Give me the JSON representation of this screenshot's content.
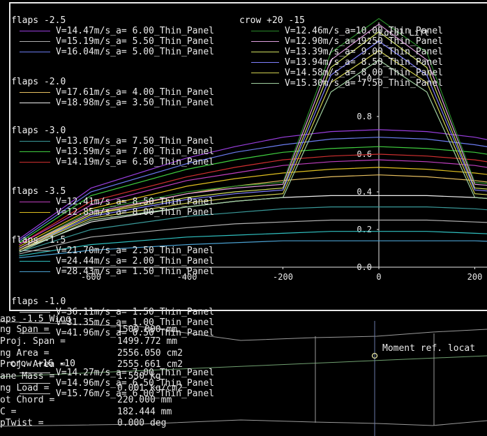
{
  "header": {
    "crow_group": "crow +20 -15"
  },
  "axes": {
    "x_ticks": [
      "-600",
      "-400",
      "-200",
      "0",
      "200"
    ],
    "y_ticks": [
      "0.0",
      "0.2",
      "0.4",
      "0.6",
      "0.8",
      "1.0",
      "1.2"
    ],
    "y_axis_label": "Local Lift"
  },
  "legend_left": {
    "g1": {
      "label": "flaps -2.5",
      "items": [
        {
          "text": "V=14.47m/s_a= 6.00_Thin_Panel",
          "color": "#9b3fe0"
        },
        {
          "text": "V=15.19m/s_a= 5.50_Thin_Panel",
          "color": "#b0b0b0"
        },
        {
          "text": "V=16.04m/s_a= 5.00_Thin_Panel",
          "color": "#6b7cf0"
        }
      ]
    },
    "g2": {
      "label": "flaps -2.0",
      "items": [
        {
          "text": "V=17.61m/s_a= 4.00_Thin_Panel",
          "color": "#e8c060"
        },
        {
          "text": "V=18.98m/s_a= 3.50_Thin_Panel",
          "color": "#f0f0f0"
        }
      ]
    },
    "g3": {
      "label": "flaps -3.0",
      "items": [
        {
          "text": "V=13.07m/s_a= 7.50_Thin_Panel",
          "color": "#3a9a9a"
        },
        {
          "text": "V=13.59m/s_a= 7.00_Thin_Panel",
          "color": "#40d040"
        },
        {
          "text": "V=14.19m/s_a= 6.50_Thin_Panel",
          "color": "#d03030"
        }
      ]
    },
    "g4": {
      "label": "flaps -3.5",
      "items": [
        {
          "text": "V=12.41m/s_a= 8.50_Thin_Panel",
          "color": "#c040c0"
        },
        {
          "text": "V=12.85m/s_a= 8.00_Thin_Panel",
          "color": "#e0c020"
        }
      ]
    },
    "g5": {
      "label": "flaps -1.5",
      "items": [
        {
          "text": "V=21.70m/s_a= 2.50_Thin_Panel",
          "color": "#b0b0b0"
        },
        {
          "text": "V=24.44m/s_a= 2.00_Thin_Panel",
          "color": "#30c0c0"
        },
        {
          "text": "V=28.43m/s_a= 1.50_Thin_Panel",
          "color": "#4aa0d0"
        }
      ]
    },
    "g6": {
      "label": "flaps -1.0",
      "items": [
        {
          "text": "V=36.11m/s_a= 1.50_Thin_Panel",
          "color": "#d0d0d0"
        },
        {
          "text": "V=31.35m/s_a= 1.00_Thin_Panel",
          "color": "#d0d0d0"
        },
        {
          "text": "V=41.96m/s_a= 0.50_Thin_Panel",
          "color": "#d0d0d0"
        }
      ]
    },
    "g7": {
      "label": "crow +16 -10",
      "items": [
        {
          "text": "V=14.27m/s_a= 7.00_Thin_Panel",
          "color": "#d0d0d0"
        },
        {
          "text": "V=14.96m/s_a= 6.50_Thin_Panel",
          "color": "#d0d0d0"
        },
        {
          "text": "V=15.76m/s_a= 6.00_Thin_Panel",
          "color": "#d0d0d0"
        }
      ]
    }
  },
  "legend_right": [
    {
      "text": "V=12.46m/s_a=10.00_Thin_Panel",
      "color": "#2a8a2a"
    },
    {
      "text": "V=12.90m/s_a= 9.50_Thin_Panel",
      "color": "#e0a0e0"
    },
    {
      "text": "V=13.39m/s_a= 9.00_Thin_Panel",
      "color": "#d0e060"
    },
    {
      "text": "V=13.94m/s_a= 8.50_Thin_Panel",
      "color": "#8080ff"
    },
    {
      "text": "V=14.58m/s_a= 8.00_Thin_Panel",
      "color": "#d0d050"
    },
    {
      "text": "V=15.30m/s_a= 7.50_Thin_Panel",
      "color": "#a0d0a0"
    }
  ],
  "wing_info": {
    "wing_name": "aps -1.5 Wing",
    "rows": [
      {
        "label": "ng Span =",
        "value": "1500.000 mm"
      },
      {
        "label": "Proj. Span =",
        "value": "1499.772 mm"
      },
      {
        "label": "ng Area =",
        "value": "2556.050 cm2"
      },
      {
        "label": "Proj. Area =",
        "value": "2555.661 cm2"
      },
      {
        "label": "ane Mass =",
        "value": "1.530 kg"
      },
      {
        "label": "ng Load =",
        "value": "0.001 kg/cm2"
      },
      {
        "label": "ot Chord =",
        "value": "220.000 mm"
      },
      {
        "label": "C =",
        "value": "182.444 mm"
      },
      {
        "label": "pTwist =",
        "value": "0.000 deg"
      }
    ]
  },
  "planform": {
    "moment_ref_label": "Moment ref. locat"
  },
  "colors": {
    "frame": "#e8e8e8",
    "background": "#000000",
    "text": "#e8e8e8"
  },
  "chart_data": {
    "type": "line",
    "ylabel": "Local Lift",
    "xlim": [
      -660,
      220
    ],
    "ylim": [
      0,
      1.3
    ],
    "grid": false,
    "x": [
      -750,
      -600,
      -400,
      -300,
      -200,
      -100,
      0,
      100,
      200,
      300,
      400,
      550,
      750
    ],
    "series": [
      {
        "color": "#9b3fe0",
        "values": [
          0.15,
          0.42,
          0.58,
          0.64,
          0.69,
          0.72,
          0.73,
          0.72,
          0.69,
          0.64,
          0.58,
          0.42,
          0.15
        ]
      },
      {
        "color": "#6b7cf0",
        "values": [
          0.14,
          0.4,
          0.55,
          0.61,
          0.65,
          0.68,
          0.69,
          0.68,
          0.65,
          0.61,
          0.55,
          0.4,
          0.14
        ]
      },
      {
        "color": "#40d040",
        "values": [
          0.13,
          0.38,
          0.52,
          0.57,
          0.61,
          0.63,
          0.64,
          0.63,
          0.61,
          0.57,
          0.52,
          0.38,
          0.13
        ]
      },
      {
        "color": "#d03030",
        "values": [
          0.12,
          0.35,
          0.48,
          0.53,
          0.57,
          0.59,
          0.6,
          0.59,
          0.57,
          0.53,
          0.48,
          0.35,
          0.12
        ]
      },
      {
        "color": "#c040c0",
        "values": [
          0.12,
          0.33,
          0.46,
          0.5,
          0.54,
          0.56,
          0.57,
          0.56,
          0.54,
          0.5,
          0.46,
          0.33,
          0.12
        ]
      },
      {
        "color": "#e0c020",
        "values": [
          0.11,
          0.31,
          0.43,
          0.47,
          0.5,
          0.52,
          0.53,
          0.52,
          0.5,
          0.47,
          0.43,
          0.31,
          0.11
        ]
      },
      {
        "color": "#e8c060",
        "values": [
          0.1,
          0.28,
          0.39,
          0.43,
          0.46,
          0.48,
          0.49,
          0.48,
          0.46,
          0.43,
          0.39,
          0.28,
          0.1
        ]
      },
      {
        "color": "#f0f0f0",
        "values": [
          0.09,
          0.24,
          0.32,
          0.35,
          0.37,
          0.38,
          0.38,
          0.38,
          0.37,
          0.35,
          0.32,
          0.24,
          0.09
        ]
      },
      {
        "color": "#3a9a9a",
        "values": [
          0.08,
          0.2,
          0.27,
          0.29,
          0.31,
          0.32,
          0.32,
          0.32,
          0.31,
          0.29,
          0.27,
          0.2,
          0.08
        ]
      },
      {
        "color": "#b0b0b0",
        "values": [
          0.07,
          0.16,
          0.21,
          0.23,
          0.24,
          0.25,
          0.25,
          0.25,
          0.24,
          0.23,
          0.21,
          0.16,
          0.07
        ]
      },
      {
        "color": "#30c0c0",
        "values": [
          0.06,
          0.12,
          0.16,
          0.17,
          0.18,
          0.19,
          0.19,
          0.19,
          0.18,
          0.17,
          0.16,
          0.12,
          0.06
        ]
      },
      {
        "color": "#4aa0d0",
        "values": [
          0.05,
          0.09,
          0.12,
          0.13,
          0.14,
          0.14,
          0.14,
          0.14,
          0.14,
          0.13,
          0.12,
          0.09,
          0.05
        ]
      },
      {
        "color": "#2a8a2a",
        "values": [
          0.1,
          0.3,
          0.4,
          0.43,
          0.45,
          1.14,
          1.32,
          1.14,
          0.45,
          0.43,
          0.4,
          0.3,
          0.1
        ]
      },
      {
        "color": "#e0a0e0",
        "values": [
          0.1,
          0.29,
          0.39,
          0.42,
          0.44,
          1.1,
          1.29,
          1.1,
          0.44,
          0.42,
          0.39,
          0.29,
          0.1
        ]
      },
      {
        "color": "#d0e060",
        "values": [
          0.09,
          0.28,
          0.37,
          0.4,
          0.42,
          1.06,
          1.25,
          1.06,
          0.42,
          0.4,
          0.37,
          0.28,
          0.09
        ]
      },
      {
        "color": "#8080ff",
        "values": [
          0.09,
          0.27,
          0.36,
          0.39,
          0.41,
          1.02,
          1.2,
          1.02,
          0.41,
          0.39,
          0.36,
          0.27,
          0.09
        ]
      },
      {
        "color": "#d0d050",
        "values": [
          0.09,
          0.26,
          0.34,
          0.37,
          0.39,
          0.98,
          1.15,
          0.98,
          0.39,
          0.37,
          0.34,
          0.26,
          0.09
        ]
      },
      {
        "color": "#a0d0a0",
        "values": [
          0.08,
          0.25,
          0.32,
          0.35,
          0.37,
          0.93,
          1.1,
          0.93,
          0.37,
          0.35,
          0.32,
          0.25,
          0.08
        ]
      }
    ]
  }
}
